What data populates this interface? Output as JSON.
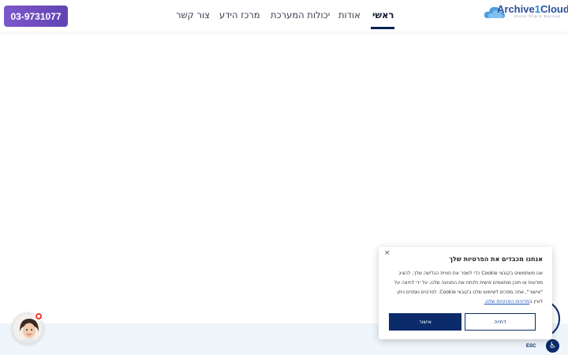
{
  "header": {
    "phone_button": "03-9731077",
    "nav": [
      {
        "label": "ראשי",
        "active": true
      },
      {
        "label": "אודות",
        "active": false
      },
      {
        "label": "יכולות המערכת",
        "active": false
      },
      {
        "label": "מרכז הידע",
        "active": false
      },
      {
        "label": "צור קשר",
        "active": false
      }
    ],
    "logo": {
      "name_part1": "Archive",
      "name_part2": "1",
      "name_part3": "Cloud",
      "tagline": "Store·Share·Backup"
    }
  },
  "accessibility": {
    "esc_label": "ESC"
  },
  "cookie_panel": {
    "title": "אנחנו מכבדים את הפרטיות שלך",
    "close": "×",
    "body": "אנו משתמשים בקובצי Cookie כדי לשפר את חוויית הגלישה שלך, להציג מודעות או תוכן מותאמים אישית ולנתח את התנועה שלנו. על ידי לחיצה על \"אישור\", אתה מסכים לשימוש שלנו בקובצי Cookie. לפרטים נוספים ניתן לעיין ב",
    "link": "מדיניות הפרטיות שלנו.",
    "reject_label": "דחייה",
    "accept_label": "אישור"
  },
  "colors": {
    "brand_purple": "#6c4bbf",
    "navy": "#0b2b6b",
    "footer_strip": "#eef5fb",
    "badge_red": "#ef3b2d"
  }
}
